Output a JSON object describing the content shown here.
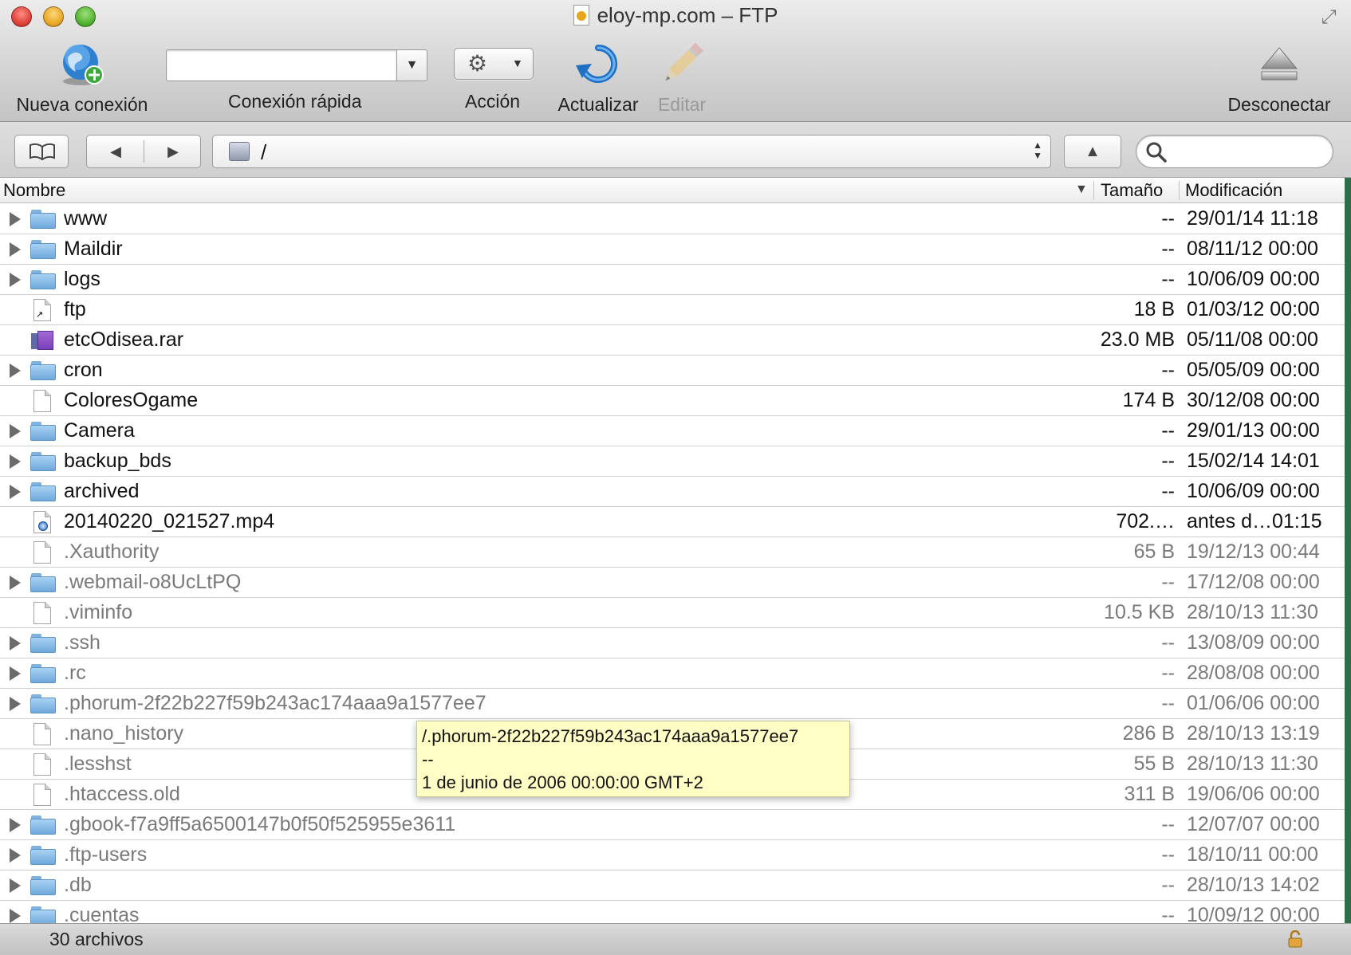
{
  "window": {
    "title": "eloy-mp.com – FTP"
  },
  "toolbar": {
    "new_connection": "Nueva conexión",
    "quick_connect": "Conexión rápida",
    "quick_connect_value": "",
    "action": "Acción",
    "refresh": "Actualizar",
    "edit": "Editar",
    "disconnect": "Desconectar"
  },
  "navigation": {
    "path": "/",
    "search_value": ""
  },
  "columns": {
    "name": "Nombre",
    "size": "Tamaño",
    "modified": "Modificación"
  },
  "files": [
    {
      "name": "www",
      "size": "--",
      "modified": "29/01/14 11:18",
      "type": "folder",
      "hidden": false
    },
    {
      "name": "Maildir",
      "size": "--",
      "modified": "08/11/12 00:00",
      "type": "folder",
      "hidden": false
    },
    {
      "name": "logs",
      "size": "--",
      "modified": "10/06/09 00:00",
      "type": "folder",
      "hidden": false
    },
    {
      "name": "ftp",
      "size": "18 B",
      "modified": "01/03/12 00:00",
      "type": "alias",
      "hidden": false
    },
    {
      "name": "etcOdisea.rar",
      "size": "23.0 MB",
      "modified": "05/11/08 00:00",
      "type": "archive",
      "hidden": false
    },
    {
      "name": "cron",
      "size": "--",
      "modified": "05/05/09 00:00",
      "type": "folder",
      "hidden": false
    },
    {
      "name": "ColoresOgame",
      "size": "174 B",
      "modified": "30/12/08 00:00",
      "type": "file",
      "hidden": false
    },
    {
      "name": "Camera",
      "size": "--",
      "modified": "29/01/13 00:00",
      "type": "folder",
      "hidden": false
    },
    {
      "name": "backup_bds",
      "size": "--",
      "modified": "15/02/14 14:01",
      "type": "folder",
      "hidden": false
    },
    {
      "name": "archived",
      "size": "--",
      "modified": "10/06/09 00:00",
      "type": "folder",
      "hidden": false
    },
    {
      "name": "20140220_021527.mp4",
      "size": "702.…",
      "modified": "antes d…01:15",
      "type": "video",
      "hidden": false
    },
    {
      "name": ".Xauthority",
      "size": "65 B",
      "modified": "19/12/13 00:44",
      "type": "file",
      "hidden": true
    },
    {
      "name": ".webmail-o8UcLtPQ",
      "size": "--",
      "modified": "17/12/08 00:00",
      "type": "folder",
      "hidden": true
    },
    {
      "name": ".viminfo",
      "size": "10.5 KB",
      "modified": "28/10/13 11:30",
      "type": "file",
      "hidden": true
    },
    {
      "name": ".ssh",
      "size": "--",
      "modified": "13/08/09 00:00",
      "type": "folder",
      "hidden": true
    },
    {
      "name": ".rc",
      "size": "--",
      "modified": "28/08/08 00:00",
      "type": "folder",
      "hidden": true
    },
    {
      "name": ".phorum-2f22b227f59b243ac174aaa9a1577ee7",
      "size": "--",
      "modified": "01/06/06 00:00",
      "type": "folder",
      "hidden": true
    },
    {
      "name": ".nano_history",
      "size": "286 B",
      "modified": "28/10/13 13:19",
      "type": "file",
      "hidden": true
    },
    {
      "name": ".lesshst",
      "size": "55 B",
      "modified": "28/10/13 11:30",
      "type": "file",
      "hidden": true
    },
    {
      "name": ".htaccess.old",
      "size": "311 B",
      "modified": "19/06/06 00:00",
      "type": "file",
      "hidden": true
    },
    {
      "name": ".gbook-f7a9ff5a6500147b0f50f525955e3611",
      "size": "--",
      "modified": "12/07/07 00:00",
      "type": "folder",
      "hidden": true
    },
    {
      "name": ".ftp-users",
      "size": "--",
      "modified": "18/10/11 00:00",
      "type": "folder",
      "hidden": true
    },
    {
      "name": ".db",
      "size": "--",
      "modified": "28/10/13 14:02",
      "type": "folder",
      "hidden": true
    },
    {
      "name": ".cuentas",
      "size": "--",
      "modified": "10/09/12 00:00",
      "type": "folder",
      "hidden": true
    }
  ],
  "tooltip": {
    "line1": "/.phorum-2f22b227f59b243ac174aaa9a1577ee7",
    "line2": "--",
    "line3": "1 de junio de 2006 00:00:00 GMT+2"
  },
  "status": {
    "count": "30 archivos"
  },
  "icons": {
    "new_connection": "globe-plus-icon",
    "action": "gear-icon",
    "refresh": "refresh-icon",
    "edit": "pencil-icon",
    "disconnect": "eject-icon",
    "bookmarks": "book-icon",
    "back": "back-arrow-icon",
    "forward": "forward-arrow-icon",
    "up": "up-arrow-icon",
    "search": "search-icon",
    "lock": "lock-icon"
  },
  "colors": {
    "tooltip_bg": "#ffffc6",
    "folder": "#7fb2e0",
    "hidden_text": "#7a7a7a"
  }
}
